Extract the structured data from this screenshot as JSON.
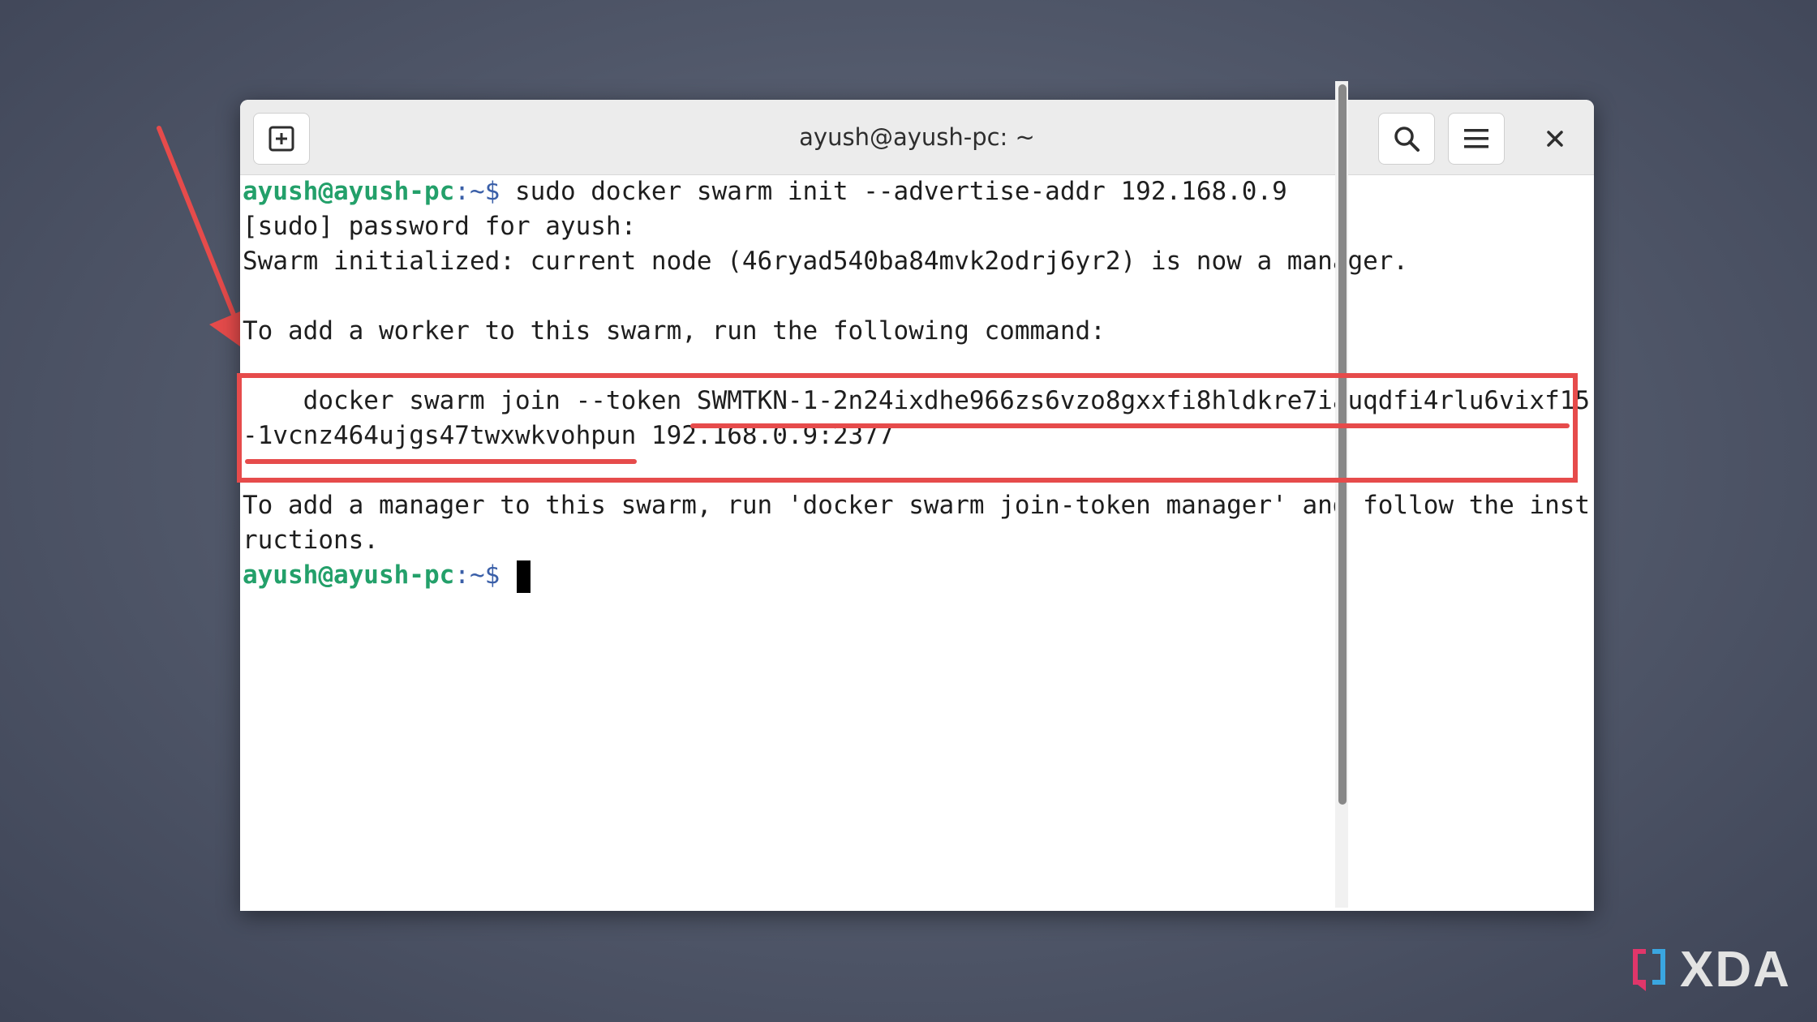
{
  "window": {
    "title": "ayush@ayush-pc: ~",
    "buttons": {
      "new_tab_icon": "new-tab-icon",
      "search_icon": "search-icon",
      "menu_icon": "hamburger-menu-icon",
      "close_glyph": "×"
    }
  },
  "terminal": {
    "prompt_user": "ayush@ayush-pc",
    "prompt_path": ":~$ ",
    "line1_cmd": "sudo docker swarm init --advertise-addr 192.168.0.9",
    "line2": "[sudo] password for ayush:",
    "line3": "Swarm initialized: current node (46ryad540ba84mvk2odrj6yr2) is now a manager.",
    "line4": "",
    "line5": "To add a worker to this swarm, run the following command:",
    "line6": "",
    "line7": "    docker swarm join --token SWMTKN-1-2n24ixdhe966zs6vzo8gxxfi8hldkre7iauqdfi4rlu6vixf15",
    "line8": "-1vcnz464ujgs47twxwkvohpun 192.168.0.9:2377",
    "line9": "",
    "line10": "To add a manager to this swarm, run 'docker swarm join-token manager' and follow the inst",
    "line11": "ructions.",
    "prompt2_user": "ayush@ayush-pc",
    "prompt2_path": ":~$ "
  },
  "colors": {
    "annotation_red": "#e64b4b",
    "prompt_green": "#23a06a"
  },
  "watermark": {
    "brand": "XDA"
  }
}
